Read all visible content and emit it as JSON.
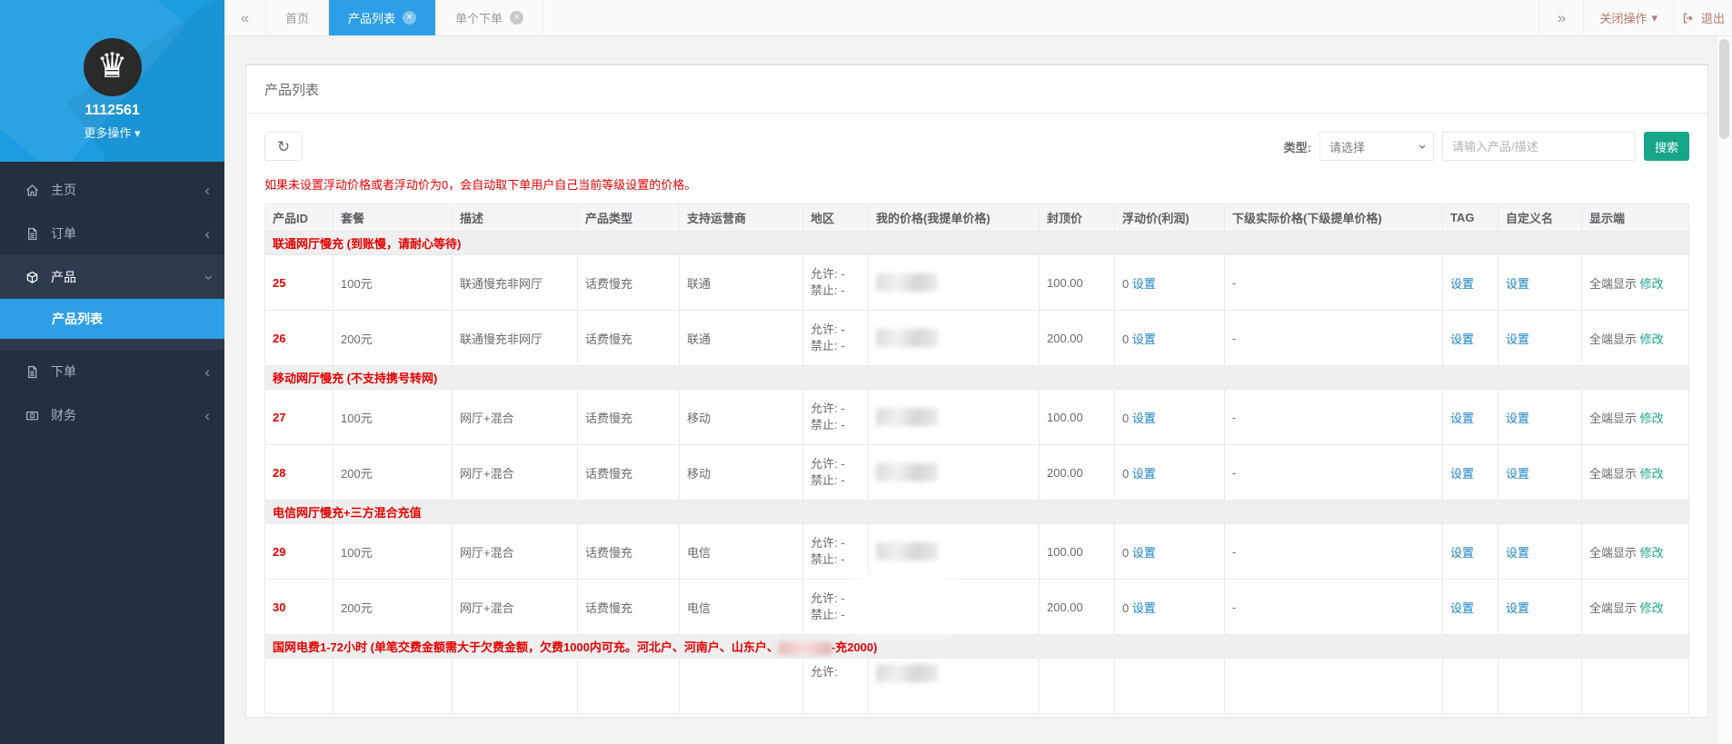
{
  "colors": {
    "accent_blue": "#2d9fe8",
    "sidebar_top_blue": "#1b9ce0",
    "sidebar_dark": "#24303e",
    "teal_green": "#18a689",
    "red": "#e60000",
    "link_blue": "#1c84c6"
  },
  "icons": {
    "logo": "♛",
    "caret_down": "▾",
    "chevron_left": "‹",
    "collapse_left": "«",
    "collapse_right": "»",
    "close": "×",
    "refresh": "↻"
  },
  "sidebar": {
    "user_id": "1112561",
    "more_actions": "更多操作",
    "menu": [
      {
        "label": "主页"
      },
      {
        "label": "订单"
      },
      {
        "label": "产品"
      },
      {
        "label": "下单"
      },
      {
        "label": "财务"
      }
    ],
    "submenu": {
      "label": "产品列表"
    }
  },
  "tabbar": {
    "tabs": [
      {
        "label": "首页"
      },
      {
        "label": "产品列表"
      },
      {
        "label": "单个下单"
      }
    ],
    "close_ops": "关闭操作",
    "logout": "退出"
  },
  "panel": {
    "title": "产品列表",
    "type_label": "类型:",
    "type_value": "请选择",
    "search_placeholder": "请输入产品/描述",
    "search_button": "搜索",
    "warning": "如果未设置浮动价格或者浮动价为0，会自动取下单用户自己当前等级设置的价格。"
  },
  "table": {
    "headers": [
      "产品ID",
      "套餐",
      "描述",
      "产品类型",
      "支持运营商",
      "地区",
      "我的价格(我提单价格)",
      "封顶价",
      "浮动价(利润)",
      "下级实际价格(下级提单价格)",
      "TAG",
      "自定义名",
      "显示端"
    ],
    "labels": {
      "set": "设置",
      "modify": "修改",
      "display_all": "全端显示",
      "dash": "-",
      "allow": "允许: -",
      "deny": "禁止: -",
      "float_zero": "0",
      "allow_partial": "允许:"
    },
    "groups": [
      {
        "title": "联通网厅慢充 (到账慢，请耐心等待)"
      },
      {
        "title": "移动网厅慢充 (不支持携号转网)"
      },
      {
        "title": "电信网厅慢充+三方混合充值"
      },
      {
        "title_before": "国网电费1-72小时 (单笔交费金额需大于欠费金额，欠费1000内可充。河北户、河南户、山东户、",
        "title_after": "-充2000)"
      }
    ],
    "rows": [
      {
        "id": "25",
        "package": "100元",
        "desc": "联通慢充非网厅",
        "type": "话费慢充",
        "carrier": "联通",
        "cap": "100.00"
      },
      {
        "id": "26",
        "package": "200元",
        "desc": "联通慢充非网厅",
        "type": "话费慢充",
        "carrier": "联通",
        "cap": "200.00"
      },
      {
        "id": "27",
        "package": "100元",
        "desc": "网厅+混合",
        "type": "话费慢充",
        "carrier": "移动",
        "cap": "100.00"
      },
      {
        "id": "28",
        "package": "200元",
        "desc": "网厅+混合",
        "type": "话费慢充",
        "carrier": "移动",
        "cap": "200.00"
      },
      {
        "id": "29",
        "package": "100元",
        "desc": "网厅+混合",
        "type": "话费慢充",
        "carrier": "电信",
        "cap": "100.00"
      },
      {
        "id": "30",
        "package": "200元",
        "desc": "网厅+混合",
        "type": "话费慢充",
        "carrier": "电信",
        "cap": "200.00"
      }
    ]
  }
}
